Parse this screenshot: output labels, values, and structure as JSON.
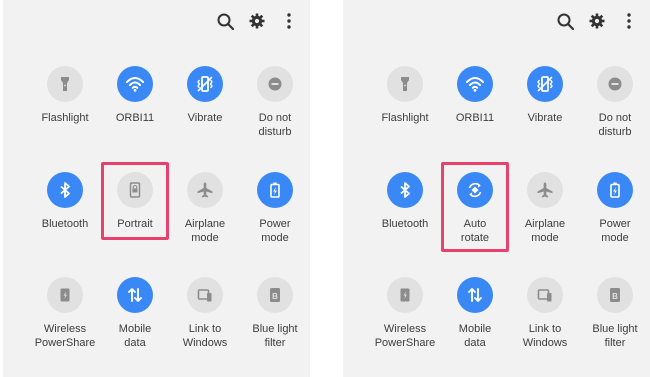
{
  "top_icons": [
    "search-icon",
    "settings-gear-icon",
    "more-options-icon"
  ],
  "colors": {
    "panel_bg": "#f2f2f2",
    "tile_on": "#3a88f5",
    "tile_off": "#e1e1e1",
    "icon_off": "#8c8c8c",
    "label": "#3d3d3d",
    "highlight": "#e8406f"
  },
  "panels": [
    {
      "tiles": [
        {
          "label": "Flashlight",
          "icon": "flashlight-icon",
          "on": false
        },
        {
          "label": "ORBI11",
          "icon": "wifi-icon",
          "on": true
        },
        {
          "label": "Vibrate",
          "icon": "vibrate-icon",
          "on": true
        },
        {
          "label": "Do not\ndisturb",
          "icon": "do-not-disturb-icon",
          "on": false
        },
        {
          "label": "Bluetooth",
          "icon": "bluetooth-icon",
          "on": true
        },
        {
          "label": "Portrait",
          "icon": "portrait-lock-icon",
          "on": false,
          "highlighted": true
        },
        {
          "label": "Airplane\nmode",
          "icon": "airplane-icon",
          "on": false
        },
        {
          "label": "Power\nmode",
          "icon": "power-mode-icon",
          "on": true
        },
        {
          "label": "Wireless\nPowerShare",
          "icon": "wireless-powershare-icon",
          "on": false
        },
        {
          "label": "Mobile\ndata",
          "icon": "mobile-data-icon",
          "on": true
        },
        {
          "label": "Link to\nWindows",
          "icon": "link-to-windows-icon",
          "on": false
        },
        {
          "label": "Blue light\nfilter",
          "icon": "blue-light-filter-icon",
          "on": false
        }
      ]
    },
    {
      "tiles": [
        {
          "label": "Flashlight",
          "icon": "flashlight-icon",
          "on": false
        },
        {
          "label": "ORBI11",
          "icon": "wifi-icon",
          "on": true
        },
        {
          "label": "Vibrate",
          "icon": "vibrate-icon",
          "on": true
        },
        {
          "label": "Do not\ndisturb",
          "icon": "do-not-disturb-icon",
          "on": false
        },
        {
          "label": "Bluetooth",
          "icon": "bluetooth-icon",
          "on": true
        },
        {
          "label": "Auto\nrotate",
          "icon": "auto-rotate-icon",
          "on": true,
          "highlighted": true
        },
        {
          "label": "Airplane\nmode",
          "icon": "airplane-icon",
          "on": false
        },
        {
          "label": "Power\nmode",
          "icon": "power-mode-icon",
          "on": true
        },
        {
          "label": "Wireless\nPowerShare",
          "icon": "wireless-powershare-icon",
          "on": false
        },
        {
          "label": "Mobile\ndata",
          "icon": "mobile-data-icon",
          "on": true
        },
        {
          "label": "Link to\nWindows",
          "icon": "link-to-windows-icon",
          "on": false
        },
        {
          "label": "Blue light\nfilter",
          "icon": "blue-light-filter-icon",
          "on": false
        }
      ]
    }
  ]
}
